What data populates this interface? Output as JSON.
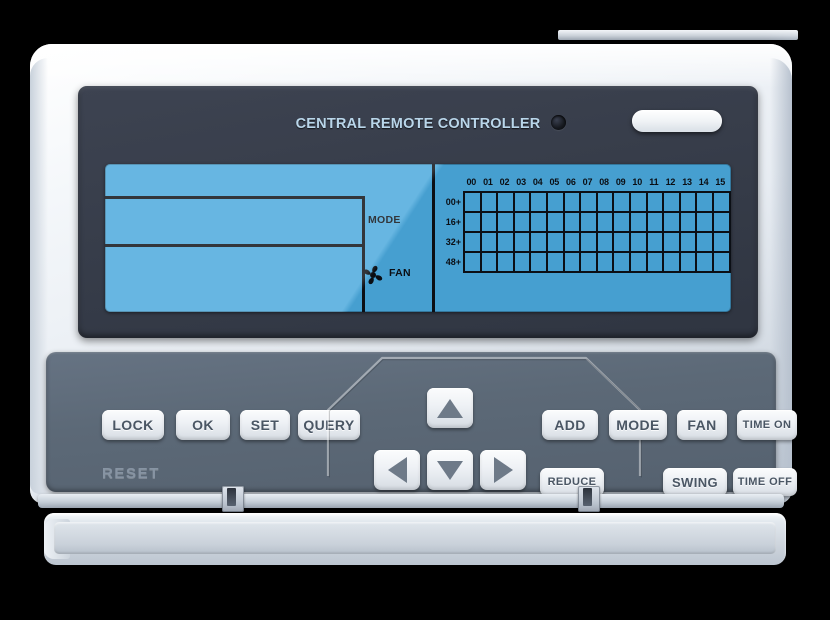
{
  "device": {
    "title": "CENTRAL REMOTE CONTROLLER",
    "reset_label": "RESET",
    "colors": {
      "lcd_blue": "#4aa8dc",
      "bezel_dark": "#383e4c",
      "keypad_slate": "#5b6877",
      "shell_white": "#eef2f7",
      "button_face": "#eef1f5",
      "button_text": "#4a5664",
      "lcd_ink": "#0b0f15",
      "title_text": "#b9d6ea"
    }
  },
  "display": {
    "mode_label": "MODE",
    "fan_label": "FAN",
    "fan_icon": "fan-icon",
    "led_icon": "led-indicator-icon",
    "ir_icon": "ir-receiver-pill",
    "grid": {
      "column_headers": [
        "00",
        "01",
        "02",
        "03",
        "04",
        "05",
        "06",
        "07",
        "08",
        "09",
        "10",
        "11",
        "12",
        "13",
        "14",
        "15"
      ],
      "row_headers": [
        "00+",
        "16+",
        "32+",
        "48+"
      ],
      "columns": 16,
      "rows": 4,
      "cells_active": []
    }
  },
  "keypad": {
    "left_buttons": [
      {
        "label": "LOCK",
        "name": "lock-button"
      },
      {
        "label": "OK",
        "name": "ok-button"
      },
      {
        "label": "SET",
        "name": "set-button"
      },
      {
        "label": "QUERY",
        "name": "query-button"
      }
    ],
    "dpad": [
      {
        "label": "",
        "name": "arrow-up-button",
        "dir": "up"
      },
      {
        "label": "",
        "name": "arrow-left-button",
        "dir": "left"
      },
      {
        "label": "",
        "name": "arrow-down-button",
        "dir": "down"
      },
      {
        "label": "",
        "name": "arrow-right-button",
        "dir": "right"
      }
    ],
    "right_row1": [
      {
        "label": "ADD",
        "name": "add-button"
      },
      {
        "label": "MODE",
        "name": "mode-button"
      },
      {
        "label": "FAN",
        "name": "fan-button"
      },
      {
        "label": "TIME ON",
        "name": "time-on-button"
      }
    ],
    "right_row2": [
      {
        "label": "REDUCE",
        "name": "reduce-button"
      },
      {
        "label": "SWING",
        "name": "swing-button"
      },
      {
        "label": "TIME OFF",
        "name": "time-off-button"
      }
    ]
  }
}
